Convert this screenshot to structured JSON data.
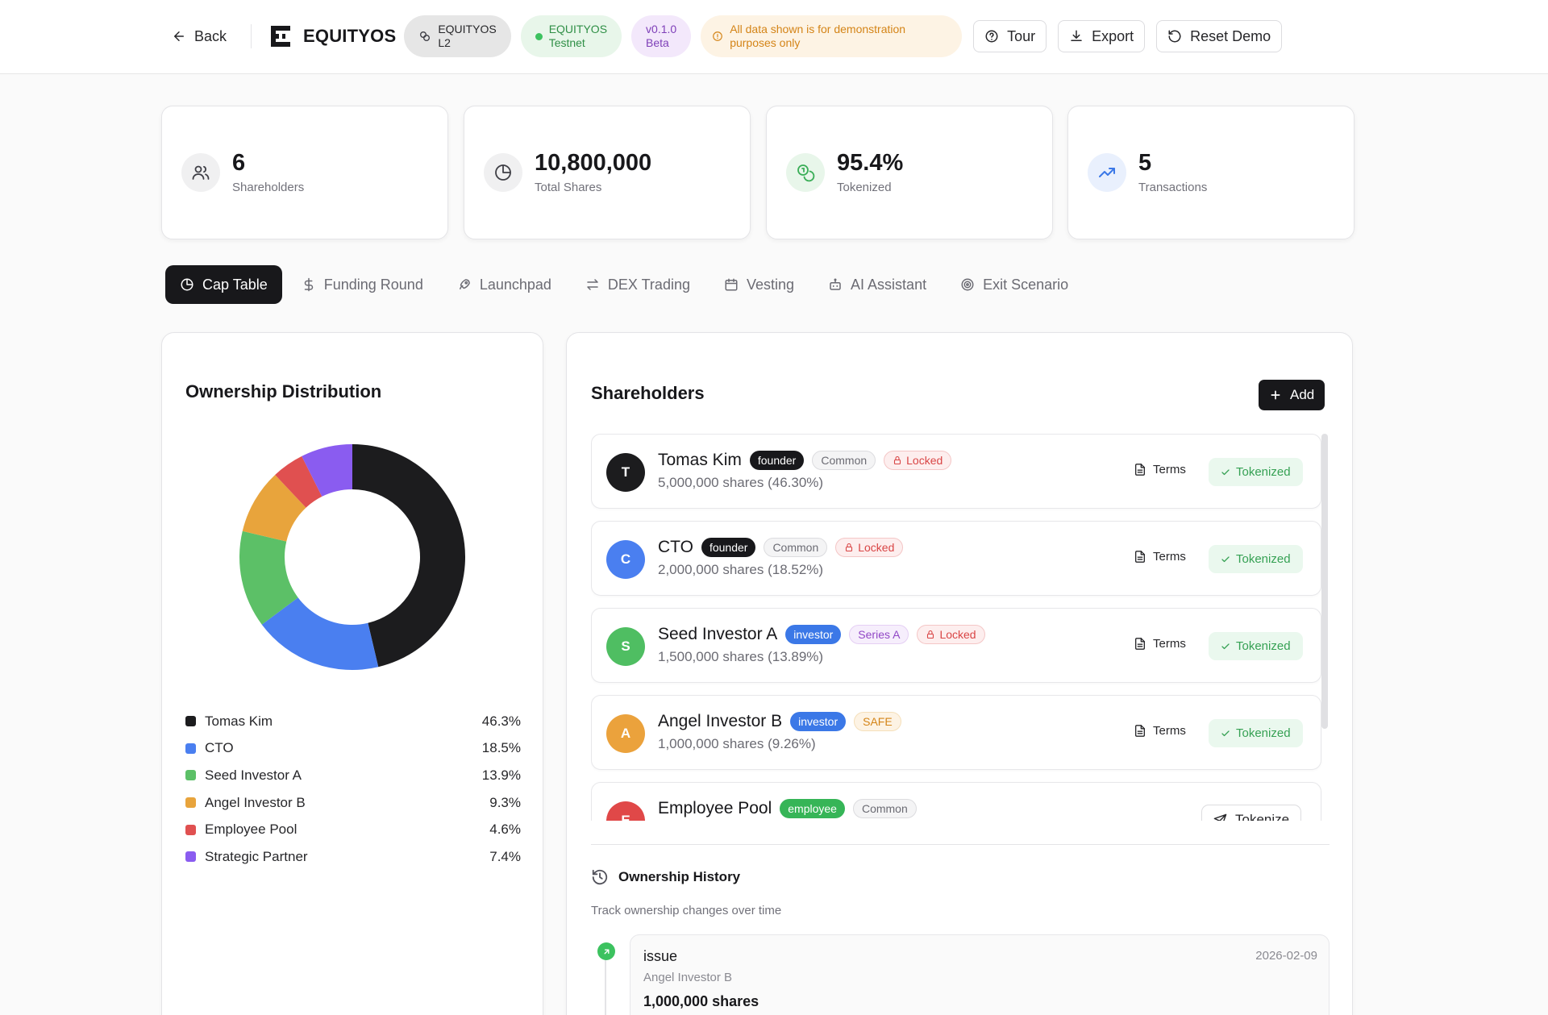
{
  "header": {
    "back_label": "Back",
    "brand": "EQUITYOS",
    "network_line1": "EQUITYOS",
    "network_line2": "L2",
    "testnet_line1": "EQUITYOS",
    "testnet_line2": "Testnet",
    "version_line1": "v0.1.0",
    "version_line2": "Beta",
    "notice_line1": "All data shown is for demonstration",
    "notice_line2": "purposes only",
    "tour_label": "Tour",
    "export_label": "Export",
    "reset_label": "Reset Demo"
  },
  "stats": [
    {
      "value": "6",
      "label": "Shareholders",
      "icon": "users-icon"
    },
    {
      "value": "10,800,000",
      "label": "Total Shares",
      "icon": "pie-chart-icon"
    },
    {
      "value": "95.4%",
      "label": "Tokenized",
      "icon": "coins-icon"
    },
    {
      "value": "5",
      "label": "Transactions",
      "icon": "trending-up-icon"
    }
  ],
  "tabs": [
    {
      "label": "Cap Table",
      "icon": "pie-chart-icon",
      "active": true
    },
    {
      "label": "Funding Round",
      "icon": "dollar-icon"
    },
    {
      "label": "Launchpad",
      "icon": "rocket-icon"
    },
    {
      "label": "DEX Trading",
      "icon": "swap-icon"
    },
    {
      "label": "Vesting",
      "icon": "calendar-icon"
    },
    {
      "label": "AI Assistant",
      "icon": "bot-icon"
    },
    {
      "label": "Exit Scenario",
      "icon": "target-icon"
    }
  ],
  "ownership": {
    "title": "Ownership Distribution",
    "legend": [
      {
        "name": "Tomas Kim",
        "pct": "46.3%",
        "color": "#1c1c1e"
      },
      {
        "name": "CTO",
        "pct": "18.5%",
        "color": "#4a7ff0"
      },
      {
        "name": "Seed Investor A",
        "pct": "13.9%",
        "color": "#5cc067"
      },
      {
        "name": "Angel Investor B",
        "pct": "9.3%",
        "color": "#e8a43c"
      },
      {
        "name": "Employee Pool",
        "pct": "4.6%",
        "color": "#e05050"
      },
      {
        "name": "Strategic Partner",
        "pct": "7.4%",
        "color": "#8a5cf0"
      }
    ]
  },
  "chart_data": {
    "type": "pie",
    "categories": [
      "Tomas Kim",
      "CTO",
      "Seed Investor A",
      "Angel Investor B",
      "Employee Pool",
      "Strategic Partner"
    ],
    "values": [
      46.3,
      18.5,
      13.9,
      9.3,
      4.6,
      7.4
    ],
    "colors": [
      "#1c1c1e",
      "#4a7ff0",
      "#5cc067",
      "#e8a43c",
      "#e05050",
      "#8a5cf0"
    ],
    "title": "Ownership Distribution",
    "style": "donut",
    "legend": "bottom"
  },
  "shareholders": {
    "title": "Shareholders",
    "add_label": "Add",
    "terms_label": "Terms",
    "tokenized_label": "Tokenized",
    "tokenize_label": "Tokenize",
    "locked_label": "Locked",
    "rows": [
      {
        "initial": "T",
        "name": "Tomas Kim",
        "role": "founder",
        "cls": "Common",
        "locked": true,
        "shares": "5,000,000 shares (46.30%)",
        "status": "tokenized",
        "avatar_color": "#1c1c1e"
      },
      {
        "initial": "C",
        "name": "CTO",
        "role": "founder",
        "cls": "Common",
        "locked": true,
        "shares": "2,000,000 shares (18.52%)",
        "status": "tokenized",
        "avatar_color": "#4a7ff0"
      },
      {
        "initial": "S",
        "name": "Seed Investor A",
        "role": "investor",
        "cls": "Series A",
        "locked": true,
        "shares": "1,500,000 shares (13.89%)",
        "status": "tokenized",
        "avatar_color": "#4fbe62"
      },
      {
        "initial": "A",
        "name": "Angel Investor B",
        "role": "investor",
        "cls": "SAFE",
        "locked": false,
        "shares": "1,000,000 shares (9.26%)",
        "status": "tokenized",
        "avatar_color": "#eba23c"
      },
      {
        "initial": "E",
        "name": "Employee Pool",
        "role": "employee",
        "cls": "Common",
        "locked": false,
        "shares": "",
        "status": "tokenize",
        "avatar_color": "#e04848"
      }
    ]
  },
  "history": {
    "title": "Ownership History",
    "subtitle": "Track ownership changes over time",
    "entries": [
      {
        "type": "issue",
        "date": "2026-02-09",
        "who": "Angel Investor B",
        "amount": "1,000,000 shares"
      }
    ]
  }
}
